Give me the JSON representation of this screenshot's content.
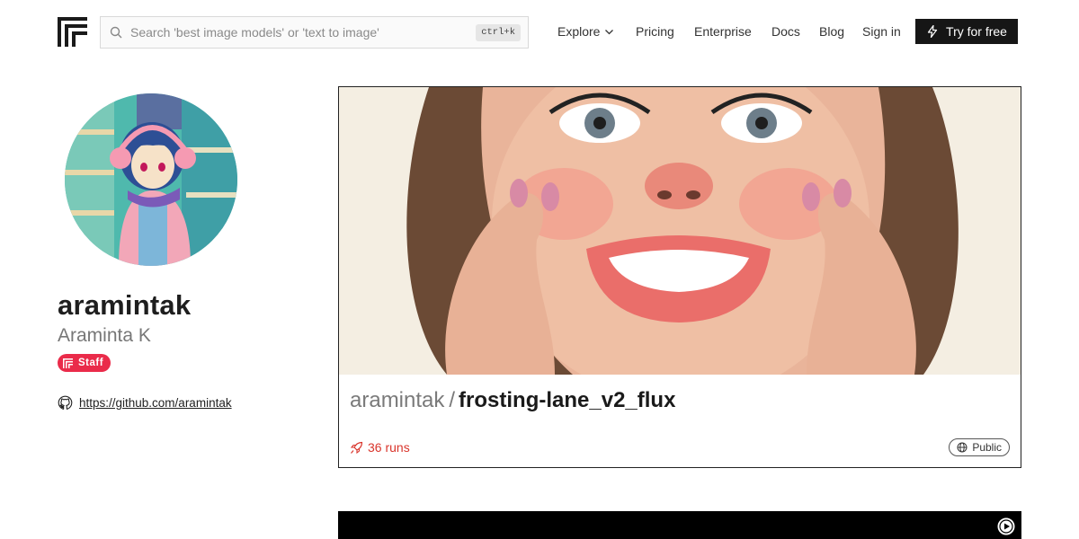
{
  "header": {
    "search_placeholder": "Search 'best image models' or 'text to image'",
    "search_shortcut": "ctrl+k",
    "nav": {
      "explore": "Explore",
      "pricing": "Pricing",
      "enterprise": "Enterprise",
      "docs": "Docs",
      "blog": "Blog",
      "signin": "Sign in"
    },
    "cta": "Try for free"
  },
  "profile": {
    "username": "aramintak",
    "full_name": "Araminta K",
    "badge": "Staff",
    "github_url": "https://github.com/aramintak"
  },
  "models": [
    {
      "owner": "aramintak",
      "separator": "/",
      "name": "frosting-lane_v2_flux",
      "runs": "36 runs",
      "visibility": "Public"
    }
  ],
  "colors": {
    "accent": "#ea2b4a",
    "runs": "#d9352c",
    "cta_bg": "#161616"
  },
  "icons": [
    "logo-icon",
    "search-icon",
    "chevron-down-icon",
    "lightning-icon",
    "github-icon",
    "rocket-icon",
    "globe-icon",
    "play-icon"
  ]
}
